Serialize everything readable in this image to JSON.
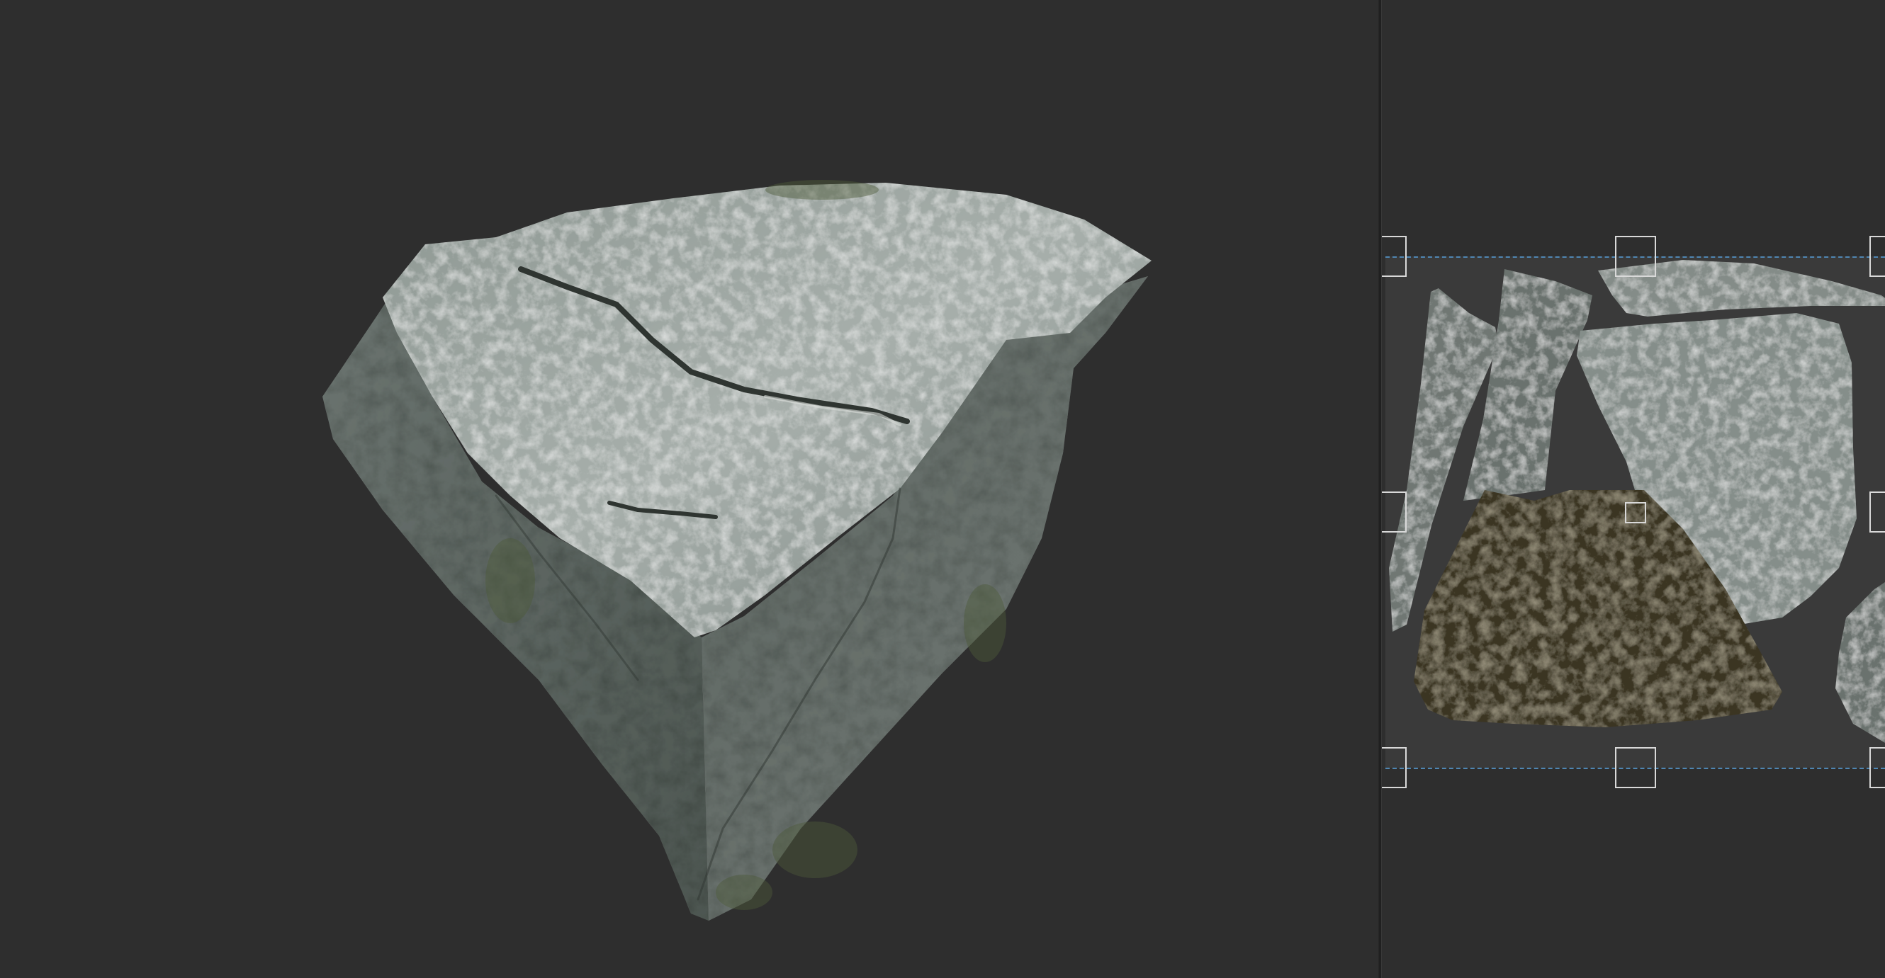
{
  "viewport_3d": {
    "background": "#2e2e2e",
    "subject": "rock-mesh"
  },
  "uv_editor": {
    "background": "#2e2e2e",
    "uv_space_color": "#3a3a3a",
    "selection_color": "#4f86b3",
    "handle_color": "#d9d9d9",
    "islands": [
      "uv-island-strip-left",
      "uv-island-strip-middle",
      "uv-island-top-sliver",
      "uv-island-top-face",
      "uv-island-dark-side",
      "uv-island-edge-right"
    ]
  },
  "colors": {
    "rock_light": "#a4aca8",
    "rock_mid": "#6f7773",
    "rock_dark": "#3e4540",
    "moss": "#4d5a3a",
    "dark_island": "#3b3524"
  }
}
